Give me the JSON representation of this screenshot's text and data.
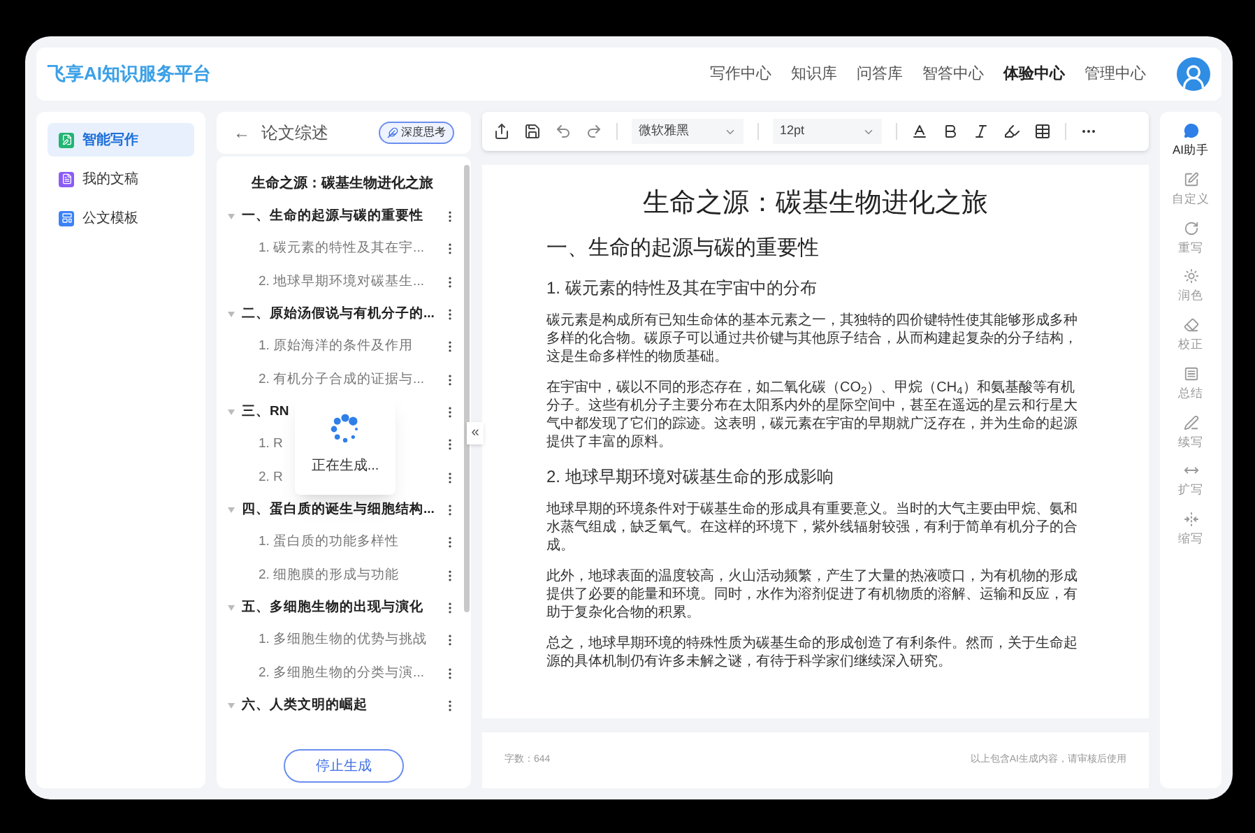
{
  "header": {
    "logo": "飞享AI知识服务平台",
    "nav": [
      {
        "label": "写作中心",
        "selected": false
      },
      {
        "label": "知识库",
        "selected": false
      },
      {
        "label": "问答库",
        "selected": false
      },
      {
        "label": "智答中心",
        "selected": false
      },
      {
        "label": "体验中心",
        "selected": true
      },
      {
        "label": "管理中心",
        "selected": false
      }
    ]
  },
  "sidebar": {
    "items": [
      {
        "label": "智能写作",
        "selected": true,
        "color": "#22b573"
      },
      {
        "label": "我的文稿",
        "selected": false,
        "color": "#8b5cf6"
      },
      {
        "label": "公文模板",
        "selected": false,
        "color": "#3b82f6"
      }
    ]
  },
  "outline": {
    "back": "←",
    "title": "论文综述",
    "badge": "深度思考",
    "doc_title": "生命之源：碳基生物进化之旅",
    "sections": [
      {
        "label": "一、生命的起源与碳的重要性",
        "expanded": true,
        "children": [
          {
            "label": "1. 碳元素的特性及其在宇..."
          },
          {
            "label": "2. 地球早期环境对碳基生..."
          }
        ]
      },
      {
        "label": "二、原始汤假说与有机分子的...",
        "expanded": true,
        "children": [
          {
            "label": "1. 原始海洋的条件及作用"
          },
          {
            "label": "2. 有机分子合成的证据与..."
          }
        ]
      },
      {
        "label": "三、RN",
        "expanded": true,
        "children": [
          {
            "label": "1. R"
          },
          {
            "label": "2. R"
          }
        ]
      },
      {
        "label": "四、蛋白质的诞生与细胞结构...",
        "expanded": true,
        "children": [
          {
            "label": "1. 蛋白质的功能多样性"
          },
          {
            "label": "2. 细胞膜的形成与功能"
          }
        ]
      },
      {
        "label": "五、多细胞生物的出现与演化",
        "expanded": true,
        "children": [
          {
            "label": "1. 多细胞生物的优势与挑战"
          },
          {
            "label": "2. 多细胞生物的分类与演..."
          }
        ]
      },
      {
        "label": "六、人类文明的崛起",
        "expanded": true
      }
    ],
    "loading": "正在生成...",
    "stop_button": "停止生成",
    "collapse": "«"
  },
  "toolbar": {
    "font": "微软雅黑",
    "size": "12pt"
  },
  "document": {
    "title": "生命之源：碳基生物进化之旅",
    "blocks": [
      {
        "kind": "h2",
        "text": "一、生命的起源与碳的重要性"
      },
      {
        "kind": "h3",
        "text": "1. 碳元素的特性及其在宇宙中的分布"
      },
      {
        "kind": "p",
        "text": "碳元素是构成所有已知生命体的基本元素之一，其独特的四价键特性使其能够形成多种多样的化合物。碳原子可以通过共价键与其他原子结合，从而构建起复杂的分子结构，这是生命多样性的物质基础。"
      },
      {
        "kind": "p",
        "text": "在宇宙中，碳以不同的形态存在，如二氧化碳（CO$_{2}$）、甲烷（CH$_{4}$）和氨基酸等有机分子。这些有机分子主要分布在太阳系内外的星际空间中，甚至在遥远的星云和行星大气中都发现了它们的踪迹。这表明，碳元素在宇宙的早期就广泛存在，并为生命的起源提供了丰富的原料。"
      },
      {
        "kind": "h3",
        "text": "2. 地球早期环境对碳基生命的形成影响"
      },
      {
        "kind": "p",
        "text": "地球早期的环境条件对于碳基生命的形成具有重要意义。当时的大气主要由甲烷、氨和水蒸气组成，缺乏氧气。在这样的环境下，紫外线辐射较强，有利于简单有机分子的合成。"
      },
      {
        "kind": "p",
        "text": "此外，地球表面的温度较高，火山活动频繁，产生了大量的热液喷口，为有机物的形成提供了必要的能量和环境。同时，水作为溶剂促进了有机物质的溶解、运输和反应，有助于复杂化合物的积累。"
      },
      {
        "kind": "p",
        "text": "总之，地球早期环境的特殊性质为碳基生命的形成创造了有利条件。然而，关于生命起源的具体机制仍有许多未解之谜，有待于科学家们继续深入研究。"
      }
    ]
  },
  "footer": {
    "word_count": "字数：644",
    "notice": "以上包含AI生成内容，请审核后使用"
  },
  "tools": [
    {
      "label": "AI助手",
      "selected": true
    },
    {
      "label": "自定义",
      "selected": false
    },
    {
      "label": "重写",
      "selected": false
    },
    {
      "label": "润色",
      "selected": false
    },
    {
      "label": "校正",
      "selected": false
    },
    {
      "label": "总结",
      "selected": false
    },
    {
      "label": "续写",
      "selected": false
    },
    {
      "label": "扩写",
      "selected": false
    },
    {
      "label": "缩写",
      "selected": false
    }
  ]
}
